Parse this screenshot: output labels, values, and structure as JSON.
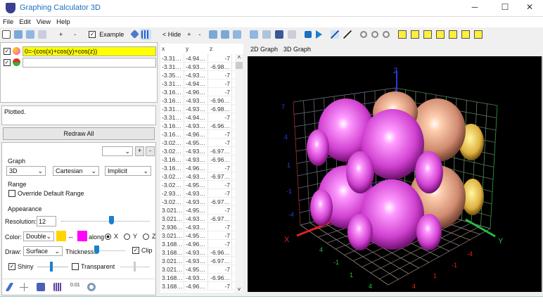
{
  "window": {
    "title": "Graphing Calculator 3D",
    "minimize": "─",
    "maximize": "☐",
    "close": "✕"
  },
  "menu": [
    "File",
    "Edit",
    "View",
    "Help"
  ],
  "left_toolbar": {
    "plus": "+",
    "minus": "-",
    "example_label": "Example",
    "example_checked": true
  },
  "equations": [
    {
      "checked": true,
      "value": "0=-(cos(x)+cos(y)+cos(z))",
      "color": "#ffff00"
    },
    {
      "checked": true,
      "value": "",
      "color": "#ffffff"
    }
  ],
  "status": "Plotted.",
  "redraw_label": "Redraw All",
  "settings": {
    "plus": "+",
    "minus": "-",
    "graph_heading": "Graph",
    "graph_dim": "3D",
    "coord_system": "Cartesian",
    "equation_type": "Implicit",
    "range_heading": "Range",
    "override_label": "Override Default Range",
    "appearance_heading": "Appearance",
    "resolution_label": "Resolution:",
    "resolution_value": "12",
    "resolution_slider": 0.55,
    "color_label": "Color:",
    "color_mode": "Double",
    "color1": "#ffd400",
    "color2": "#ff00ff",
    "swap": "↔",
    "along_label": "along",
    "axes": [
      "X",
      "Y",
      "Z"
    ],
    "along_selected": "X",
    "draw_label": "Draw:",
    "draw_mode": "Surface",
    "thickness_label": "Thickness:",
    "thickness_slider": 0.05,
    "clip_label": "Clip",
    "clip_checked": true,
    "shiny_label": "Shiny",
    "shiny_checked": true,
    "shiny_slider": 0.45,
    "transparent_label": "Transparent",
    "transparent_checked": false,
    "transparent_slider": 0.5
  },
  "table": {
    "hide_label": "< Hide",
    "plus": "+",
    "minus": "-",
    "columns": [
      "x",
      "y",
      "z"
    ],
    "rows": [
      [
        "-3.31…",
        "-4.94…",
        "-7"
      ],
      [
        "-3.31…",
        "-4.93…",
        "-6.98…"
      ],
      [
        "-3.35…",
        "-4.93…",
        "-7"
      ],
      [
        "-3.31…",
        "-4.94…",
        "-7"
      ],
      [
        "-3.16…",
        "-4.96…",
        "-7"
      ],
      [
        "-3.16…",
        "-4.93…",
        "-6.96…"
      ],
      [
        "-3.31…",
        "-4.93…",
        "-6.98…"
      ],
      [
        "-3.31…",
        "-4.94…",
        "-7"
      ],
      [
        "-3.16…",
        "-4.93…",
        "-6.96…"
      ],
      [
        "-3.16…",
        "-4.96…",
        "-7"
      ],
      [
        "-3.02…",
        "-4.95…",
        "-7"
      ],
      [
        "-3.02…",
        "-4.93…",
        "-6.97…"
      ],
      [
        "-3.16…",
        "-4.93…",
        "-6.96…"
      ],
      [
        "-3.16…",
        "-4.96…",
        "-7"
      ],
      [
        "-3.02…",
        "-4.93…",
        "-6.97…"
      ],
      [
        "-3.02…",
        "-4.95…",
        "-7"
      ],
      [
        "-2.93…",
        "-4.93…",
        "-7"
      ],
      [
        "-3.02…",
        "-4.93…",
        "-6.97…"
      ],
      [
        "3.021…",
        "-4.95…",
        "-7"
      ],
      [
        "3.021…",
        "-4.93…",
        "-6.97…"
      ],
      [
        "2.936…",
        "-4.93…",
        "-7"
      ],
      [
        "3.021…",
        "-4.95…",
        "-7"
      ],
      [
        "3.168…",
        "-4.96…",
        "-7"
      ],
      [
        "3.168…",
        "-4.93…",
        "-6.96…"
      ],
      [
        "3.021…",
        "-4.93…",
        "-6.97…"
      ],
      [
        "3.021…",
        "-4.95…",
        "-7"
      ],
      [
        "3.168…",
        "-4.93…",
        "-6.96…"
      ],
      [
        "3.168…",
        "-4.96…",
        "-7"
      ]
    ]
  },
  "graph": {
    "tabs": [
      "2D Graph",
      "3D Graph"
    ],
    "active_tab": "3D Graph",
    "axis_labels": {
      "x": "X",
      "y": "Y",
      "z": "Z"
    },
    "z_ticks": [
      "7",
      "4",
      "1",
      "-1",
      "-4"
    ],
    "x_ticks": [
      "4",
      "-1",
      "1",
      "4"
    ],
    "y_ticks": [
      "-4",
      "-1",
      "1",
      "4"
    ]
  }
}
